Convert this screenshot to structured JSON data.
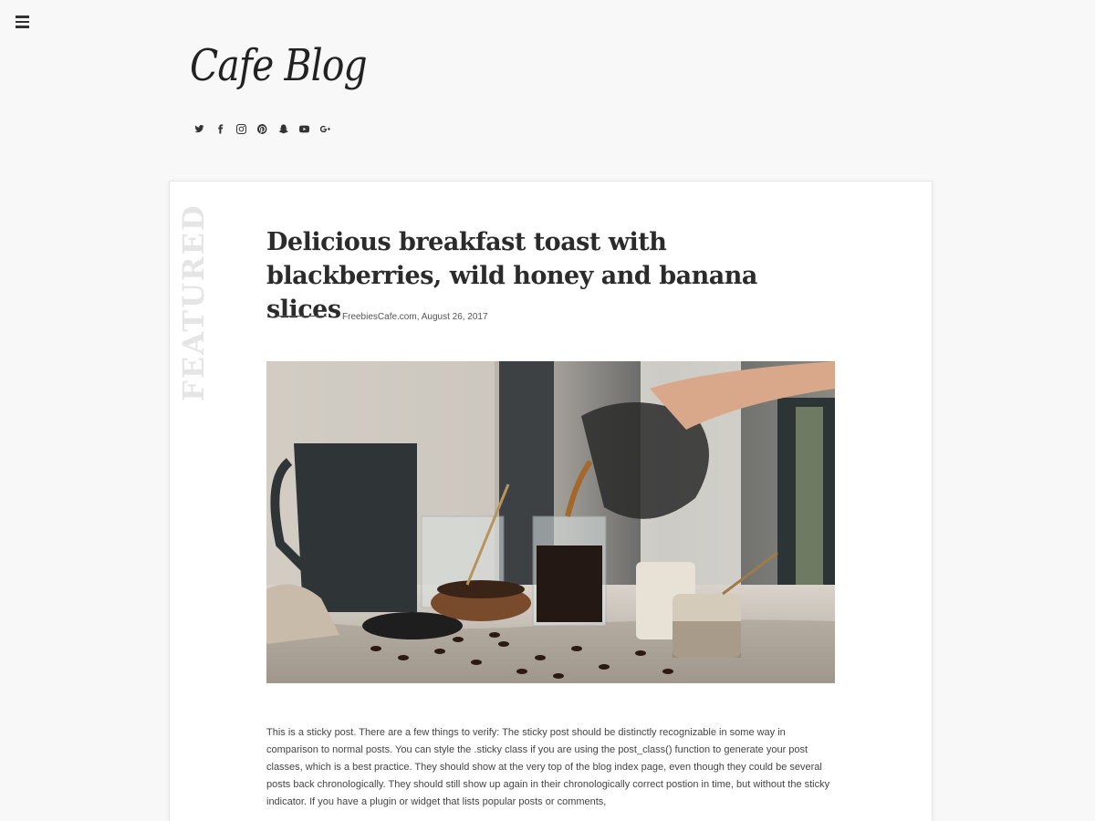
{
  "site": {
    "title": "Cafe Blog"
  },
  "social_icons": [
    "twitter-icon",
    "facebook-icon",
    "instagram-icon",
    "pinterest-icon",
    "snapchat-icon",
    "youtube-icon",
    "google-plus-icon"
  ],
  "post": {
    "badge": "FEATURED",
    "title": "Delicious breakfast toast with blackberries, wild honey and banana slices",
    "author": "FreebiesCafe.com",
    "date": "August 26, 2017",
    "excerpt": "This is a sticky post. There are a few things to verify: The sticky post should be distinctly recognizable in some way in comparison to normal posts. You can style the .sticky class if you are using the post_class() function to generate your post classes, which is a best practice. They should show at the very top of the blog index page, even though they could be several posts back chronologically. They should still show up again in their chronologically correct postion in time, but without the sticky indicator. If you have a plugin or widget that lists popular posts or comments,"
  },
  "colors": {
    "background": "#f8f8f8",
    "card": "#ffffff",
    "text": "#333333",
    "featured_watermark": "#e5e5e5"
  }
}
